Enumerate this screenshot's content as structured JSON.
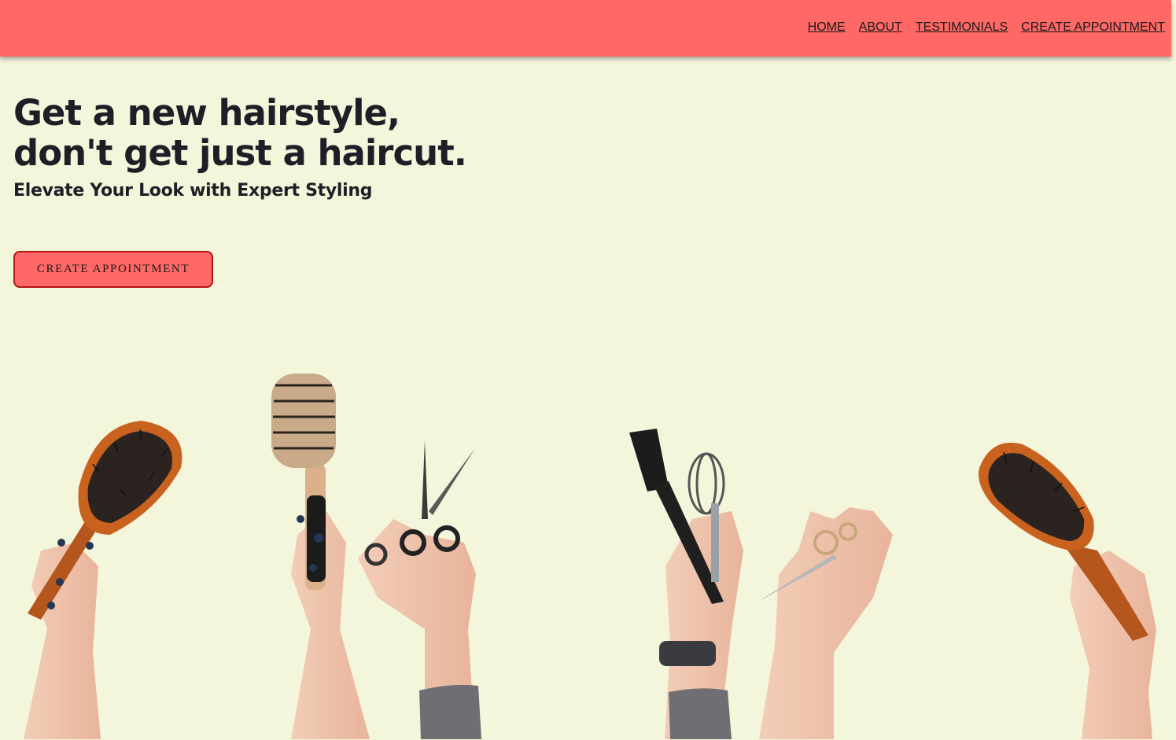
{
  "nav": {
    "items": [
      {
        "label": "HOME"
      },
      {
        "label": "ABOUT"
      },
      {
        "label": "TESTIMONIALS"
      },
      {
        "label": "CREATE APPOINTMENT"
      }
    ]
  },
  "hero": {
    "title_line1": "Get a new hairstyle,",
    "title_line2": "don't get just a haircut.",
    "subtitle": "Elevate Your Look with Expert Styling",
    "cta_label": "CREATE APPOINTMENT"
  },
  "colors": {
    "navbar": "#ff6864",
    "background": "#f4f6dc",
    "button_border": "#b01616",
    "text": "#1e1f26"
  },
  "image": {
    "icons": [
      "paddle-brush-icon",
      "round-brush-icon",
      "scissors-icon",
      "tint-brush-icon",
      "whisk-icon",
      "thinning-scissors-icon",
      "paddle-brush-icon"
    ]
  }
}
